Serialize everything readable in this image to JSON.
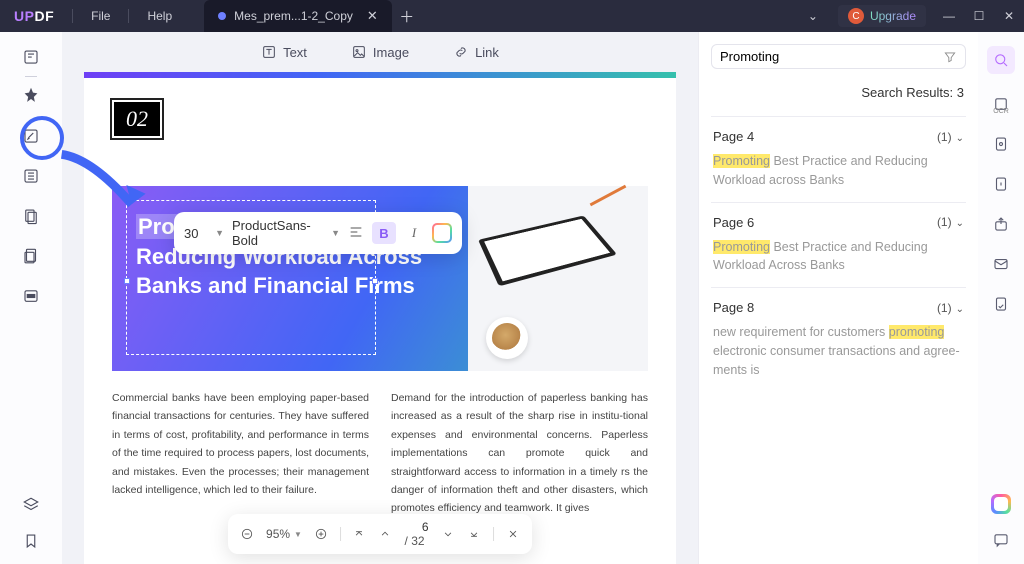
{
  "app": {
    "logo": "UPDF"
  },
  "menu": {
    "file": "File",
    "help": "Help"
  },
  "tab": {
    "title": "Mes_prem...1-2_Copy"
  },
  "upgrade": {
    "badge": "C",
    "label": "Upgrade"
  },
  "toolbar": {
    "text": "Text",
    "image": "Image",
    "link": "Link"
  },
  "page": {
    "chapter": "02",
    "heading": {
      "hl": "Promoting",
      "rest": "Best Practice and Reducing Workload Across Banks and Financial Firms"
    },
    "col1": "Commercial banks have been employing paper-based financial transactions for centuries. They have suffered in terms of cost, profitability, and performance in terms of the time required to process papers, lost documents, and mistakes. Even the processes; their management lacked intelligence, which led to their failure.",
    "col2": "Demand for the introduction of paperless banking has increased as a result of the sharp rise in institu-tional expenses and environmental concerns. Paperless implementations can promote quick and straightforward access to information in a timely rs the danger of information theft and other disasters, which promotes efficiency and teamwork. It gives"
  },
  "format": {
    "size": "30",
    "font": "ProductSans-Bold",
    "bold": "B",
    "italic": "I"
  },
  "pagectrl": {
    "zoom": "95%",
    "current": "6",
    "sep": "/",
    "total": "32"
  },
  "search": {
    "query": "Promoting",
    "resultsLabel": "Search Results: 3",
    "items": [
      {
        "page": "Page 4",
        "count": "(1)",
        "match": "Promoting",
        "rest": " Best Practice and Reducing Workload across Banks"
      },
      {
        "page": "Page 6",
        "count": "(1)",
        "match": "Promoting",
        "rest": " Best Practice and Reducing Workload Across Banks"
      },
      {
        "page": "Page 8",
        "count": "(1)",
        "pre": "new requirement for customers ",
        "match": "promoting",
        "rest": " electronic consumer transactions and agree-ments is"
      }
    ]
  },
  "ocr": {
    "label": "OCR"
  }
}
